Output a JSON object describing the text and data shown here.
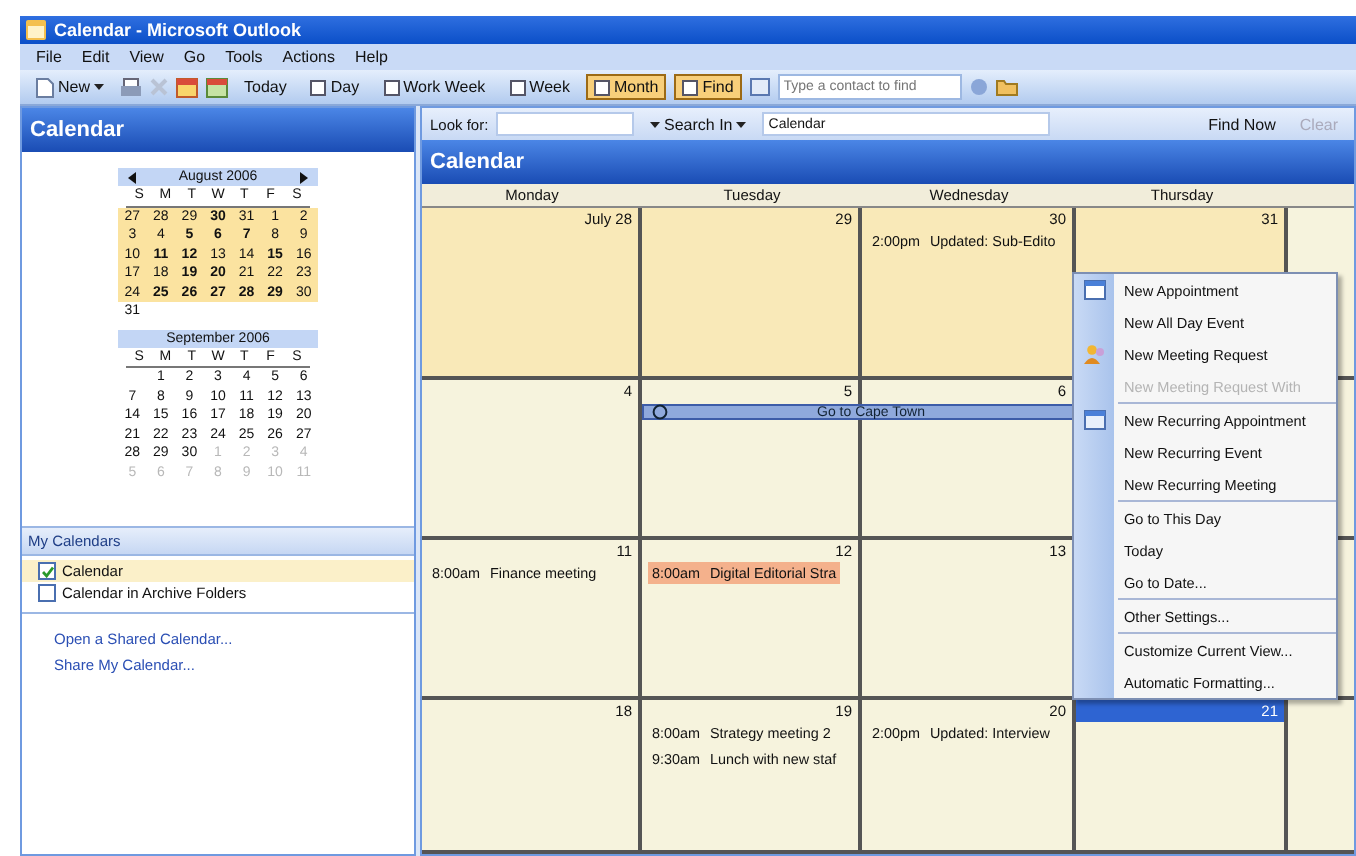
{
  "window": {
    "title": "Calendar - Microsoft Outlook"
  },
  "menu_bar": [
    "File",
    "Edit",
    "View",
    "Go",
    "Tools",
    "Actions",
    "Help"
  ],
  "toolbar": {
    "new_label": "New",
    "buttons": [
      {
        "label": "Today",
        "selected": false
      },
      {
        "label": "Day",
        "selected": false
      },
      {
        "label": "Work Week",
        "selected": false
      },
      {
        "label": "Week",
        "selected": false
      },
      {
        "label": "Month",
        "selected": true
      },
      {
        "label": "Find",
        "selected": true
      }
    ],
    "contact_search": {
      "placeholder": "Type a contact to find"
    }
  },
  "navigation": {
    "title": "Calendar",
    "mini_calendars": [
      {
        "title": "August 2006",
        "arrows": true,
        "weekdays": [
          "S",
          "M",
          "T",
          "W",
          "T",
          "F",
          "S"
        ],
        "weeks": [
          {
            "selected": true,
            "days": [
              {
                "day": "27",
                "bold": false,
                "dimmed": false
              },
              {
                "day": "28",
                "bold": false,
                "dimmed": false
              },
              {
                "day": "29",
                "bold": false,
                "dimmed": false
              },
              {
                "day": "30",
                "bold": true,
                "dimmed": false
              },
              {
                "day": "31",
                "bold": false,
                "dimmed": false
              },
              {
                "day": "1",
                "bold": false,
                "dimmed": false
              },
              {
                "day": "2",
                "bold": false,
                "dimmed": false
              }
            ]
          },
          {
            "selected": true,
            "days": [
              {
                "day": "3",
                "bold": false,
                "dimmed": false
              },
              {
                "day": "4",
                "bold": false,
                "dimmed": false
              },
              {
                "day": "5",
                "bold": true,
                "dimmed": false
              },
              {
                "day": "6",
                "bold": true,
                "dimmed": false
              },
              {
                "day": "7",
                "bold": true,
                "dimmed": false
              },
              {
                "day": "8",
                "bold": false,
                "dimmed": false
              },
              {
                "day": "9",
                "bold": false,
                "dimmed": false
              }
            ]
          },
          {
            "selected": true,
            "days": [
              {
                "day": "10",
                "bold": false,
                "dimmed": false
              },
              {
                "day": "11",
                "bold": true,
                "dimmed": false
              },
              {
                "day": "12",
                "bold": true,
                "dimmed": false
              },
              {
                "day": "13",
                "bold": false,
                "dimmed": false
              },
              {
                "day": "14",
                "bold": false,
                "dimmed": false
              },
              {
                "day": "15",
                "bold": true,
                "dimmed": false
              },
              {
                "day": "16",
                "bold": false,
                "dimmed": false
              }
            ]
          },
          {
            "selected": true,
            "days": [
              {
                "day": "17",
                "bold": false,
                "dimmed": false
              },
              {
                "day": "18",
                "bold": false,
                "dimmed": false
              },
              {
                "day": "19",
                "bold": true,
                "dimmed": false
              },
              {
                "day": "20",
                "bold": true,
                "dimmed": false
              },
              {
                "day": "21",
                "bold": false,
                "dimmed": false
              },
              {
                "day": "22",
                "bold": false,
                "dimmed": false
              },
              {
                "day": "23",
                "bold": false,
                "dimmed": false
              }
            ]
          },
          {
            "selected": true,
            "days": [
              {
                "day": "24",
                "bold": false,
                "dimmed": false
              },
              {
                "day": "25",
                "bold": true,
                "dimmed": false
              },
              {
                "day": "26",
                "bold": true,
                "dimmed": false
              },
              {
                "day": "27",
                "bold": true,
                "dimmed": false
              },
              {
                "day": "28",
                "bold": true,
                "dimmed": false
              },
              {
                "day": "29",
                "bold": true,
                "dimmed": false
              },
              {
                "day": "30",
                "bold": false,
                "dimmed": false
              }
            ]
          },
          {
            "selected": false,
            "days": [
              {
                "day": "31",
                "bold": false,
                "dimmed": false
              }
            ]
          }
        ]
      },
      {
        "title": "September 2006",
        "arrows": false,
        "weekdays": [
          "S",
          "M",
          "T",
          "W",
          "T",
          "F",
          "S"
        ],
        "weeks": [
          {
            "selected": false,
            "lead_blank": true,
            "days": [
              {
                "day": "1",
                "bold": false,
                "dimmed": false
              },
              {
                "day": "2",
                "bold": false,
                "dimmed": false
              },
              {
                "day": "3",
                "bold": false,
                "dimmed": false
              },
              {
                "day": "4",
                "bold": false,
                "dimmed": false
              },
              {
                "day": "5",
                "bold": false,
                "dimmed": false
              },
              {
                "day": "6",
                "bold": false,
                "dimmed": false
              }
            ]
          },
          {
            "selected": false,
            "days": [
              {
                "day": "7",
                "bold": false,
                "dimmed": false
              },
              {
                "day": "8",
                "bold": false,
                "dimmed": false
              },
              {
                "day": "9",
                "bold": false,
                "dimmed": false
              },
              {
                "day": "10",
                "bold": false,
                "dimmed": false
              },
              {
                "day": "11",
                "bold": false,
                "dimmed": false
              },
              {
                "day": "12",
                "bold": false,
                "dimmed": false
              },
              {
                "day": "13",
                "bold": false,
                "dimmed": false
              }
            ]
          },
          {
            "selected": false,
            "days": [
              {
                "day": "14",
                "bold": false,
                "dimmed": false
              },
              {
                "day": "15",
                "bold": false,
                "dimmed": false
              },
              {
                "day": "16",
                "bold": false,
                "dimmed": false
              },
              {
                "day": "17",
                "bold": false,
                "dimmed": false
              },
              {
                "day": "18",
                "bold": false,
                "dimmed": false
              },
              {
                "day": "19",
                "bold": false,
                "dimmed": false
              },
              {
                "day": "20",
                "bold": false,
                "dimmed": false
              }
            ]
          },
          {
            "selected": false,
            "days": [
              {
                "day": "21",
                "bold": false,
                "dimmed": false
              },
              {
                "day": "22",
                "bold": false,
                "dimmed": false
              },
              {
                "day": "23",
                "bold": false,
                "dimmed": false
              },
              {
                "day": "24",
                "bold": false,
                "dimmed": false
              },
              {
                "day": "25",
                "bold": false,
                "dimmed": false
              },
              {
                "day": "26",
                "bold": false,
                "dimmed": false
              },
              {
                "day": "27",
                "bold": false,
                "dimmed": false
              }
            ]
          },
          {
            "selected": false,
            "days": [
              {
                "day": "28",
                "bold": false,
                "dimmed": false
              },
              {
                "day": "29",
                "bold": false,
                "dimmed": false
              },
              {
                "day": "30",
                "bold": false,
                "dimmed": false
              },
              {
                "day": "1",
                "bold": false,
                "dimmed": true
              },
              {
                "day": "2",
                "bold": false,
                "dimmed": true
              },
              {
                "day": "3",
                "bold": false,
                "dimmed": true
              },
              {
                "day": "4",
                "bold": false,
                "dimmed": true
              }
            ]
          },
          {
            "selected": false,
            "days": [
              {
                "day": "5",
                "bold": false,
                "dimmed": true
              },
              {
                "day": "6",
                "bold": false,
                "dimmed": true
              },
              {
                "day": "7",
                "bold": false,
                "dimmed": true
              },
              {
                "day": "8",
                "bold": false,
                "dimmed": true
              },
              {
                "day": "9",
                "bold": false,
                "dimmed": true
              },
              {
                "day": "10",
                "bold": false,
                "dimmed": true
              },
              {
                "day": "11",
                "bold": false,
                "dimmed": true
              }
            ]
          }
        ]
      }
    ],
    "my_calendars": {
      "title": "My Calendars",
      "items": [
        {
          "label": "Calendar",
          "checked": true,
          "selected": true
        },
        {
          "label": "Calendar in Archive Folders",
          "checked": false,
          "selected": false
        }
      ]
    },
    "links": [
      "Open a Shared Calendar...",
      "Share My Calendar..."
    ]
  },
  "search_bar": {
    "look_for_label": "Look for:",
    "search_in_label": "Search In",
    "search_in_value": "Calendar",
    "find_now": "Find Now",
    "clear": {
      "label": "Clear",
      "disabled": true
    }
  },
  "calendar": {
    "title": "Calendar",
    "days_of_week": [
      "Monday",
      "Tuesday",
      "Wednesday",
      "Thursday"
    ],
    "weeks": [
      {
        "days": [
          {
            "date": "July 28",
            "other_month": true,
            "selected": false,
            "in_banner": false
          },
          {
            "date": "29",
            "other_month": true,
            "selected": false,
            "in_banner": false
          },
          {
            "date": "30",
            "other_month": true,
            "selected": false,
            "in_banner": false,
            "events": [
              {
                "time": "2:00pm",
                "title": "Updated: Sub-Edito"
              }
            ]
          },
          {
            "date": "31",
            "other_month": true,
            "selected": false,
            "in_banner": false
          }
        ]
      },
      {
        "banner_title": "Go to Cape Town",
        "days": [
          {
            "date": "4",
            "other_month": false,
            "selected": false,
            "in_banner": false
          },
          {
            "date": "5",
            "other_month": false,
            "selected": false,
            "in_banner": true
          },
          {
            "date": "6",
            "other_month": false,
            "selected": false,
            "in_banner": true
          }
        ]
      },
      {
        "days": [
          {
            "date": "11",
            "other_month": false,
            "selected": false,
            "in_banner": false,
            "events": [
              {
                "time": "8:00am",
                "title": "Finance meeting"
              }
            ]
          },
          {
            "date": "12",
            "other_month": false,
            "selected": false,
            "in_banner": false,
            "events": [
              {
                "time": "8:00am",
                "title": "Digital Editorial Stra",
                "color": "#f4b18c"
              }
            ]
          },
          {
            "date": "13",
            "other_month": false,
            "selected": false,
            "in_banner": false
          }
        ]
      },
      {
        "days": [
          {
            "date": "18",
            "other_month": false,
            "selected": false,
            "in_banner": false
          },
          {
            "date": "19",
            "other_month": false,
            "selected": false,
            "in_banner": false,
            "events": [
              {
                "time": "8:00am",
                "title": "Strategy meeting 2"
              },
              {
                "time": "9:30am",
                "title": "Lunch with new staf"
              }
            ]
          },
          {
            "date": "20",
            "other_month": false,
            "selected": false,
            "in_banner": false,
            "events": [
              {
                "time": "2:00pm",
                "title": "Updated: Interview"
              }
            ]
          },
          {
            "date": "21",
            "other_month": false,
            "selected": true,
            "in_banner": false
          }
        ]
      }
    ]
  },
  "context_menu": [
    {
      "items": [
        {
          "label": "New Appointment",
          "disabled": false,
          "kind": "appointment"
        },
        {
          "label": "New All Day Event",
          "disabled": false,
          "kind": "plain"
        },
        {
          "label": "New Meeting Request",
          "disabled": false,
          "kind": "meeting"
        },
        {
          "label": "New Meeting Request With",
          "disabled": true,
          "kind": "plain"
        }
      ]
    },
    {
      "items": [
        {
          "label": "New Recurring Appointment",
          "disabled": false,
          "kind": "recurring"
        },
        {
          "label": "New Recurring Event",
          "disabled": false,
          "kind": "plain"
        },
        {
          "label": "New Recurring Meeting",
          "disabled": false,
          "kind": "plain"
        }
      ]
    },
    {
      "items": [
        {
          "label": "Go to This Day",
          "disabled": false,
          "kind": "plain"
        },
        {
          "label": "Today",
          "disabled": false,
          "kind": "plain"
        },
        {
          "label": "Go to Date...",
          "disabled": false,
          "kind": "plain"
        }
      ]
    },
    {
      "items": [
        {
          "label": "Other Settings...",
          "disabled": false,
          "kind": "plain"
        }
      ]
    },
    {
      "items": [
        {
          "label": "Customize Current View...",
          "disabled": false,
          "kind": "plain"
        },
        {
          "label": "Automatic Formatting...",
          "disabled": false,
          "kind": "plain"
        }
      ]
    }
  ]
}
